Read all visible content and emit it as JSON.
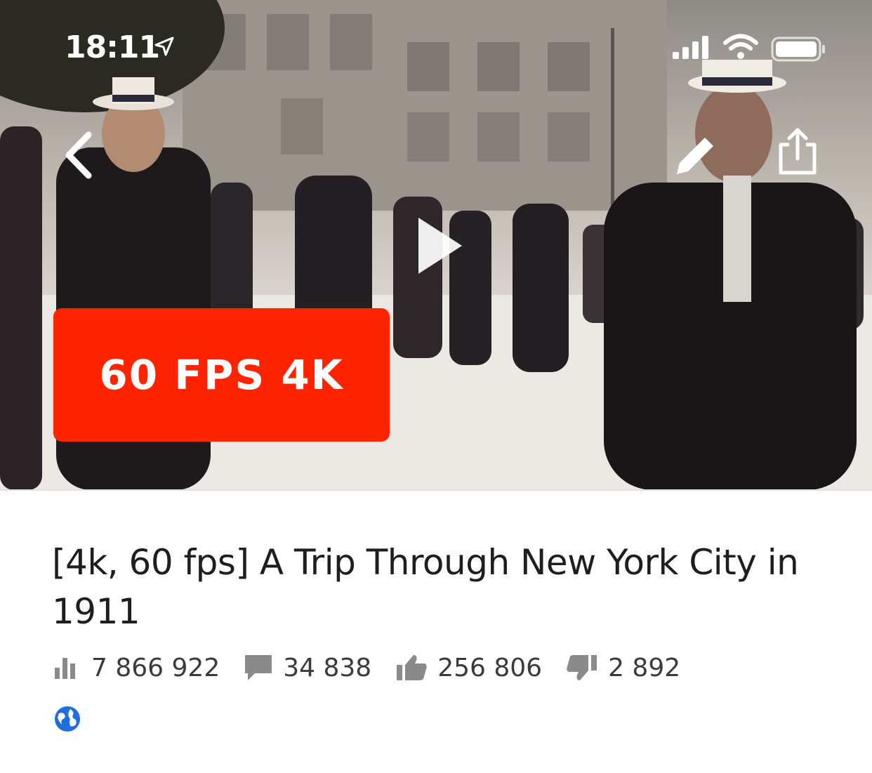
{
  "status_bar": {
    "time": "18:11"
  },
  "video": {
    "badge": "60 FPS 4K",
    "title": "[4k, 60 fps] A Trip Through New York City in 1911"
  },
  "stats": {
    "views": "7 866 922",
    "comments": "34 838",
    "likes": "256 806",
    "dislikes": "2 892"
  },
  "colors": {
    "badge_bg": "#ff2400",
    "globe": "#1e6fd9",
    "stat_icon": "#8a8a8a"
  },
  "icons": [
    "location-arrow-icon",
    "signal-icon",
    "wifi-icon",
    "battery-icon",
    "back-chevron-icon",
    "pencil-icon",
    "share-icon",
    "play-icon",
    "views-bar-icon",
    "comment-icon",
    "thumbs-up-icon",
    "thumbs-down-icon",
    "globe-icon"
  ]
}
